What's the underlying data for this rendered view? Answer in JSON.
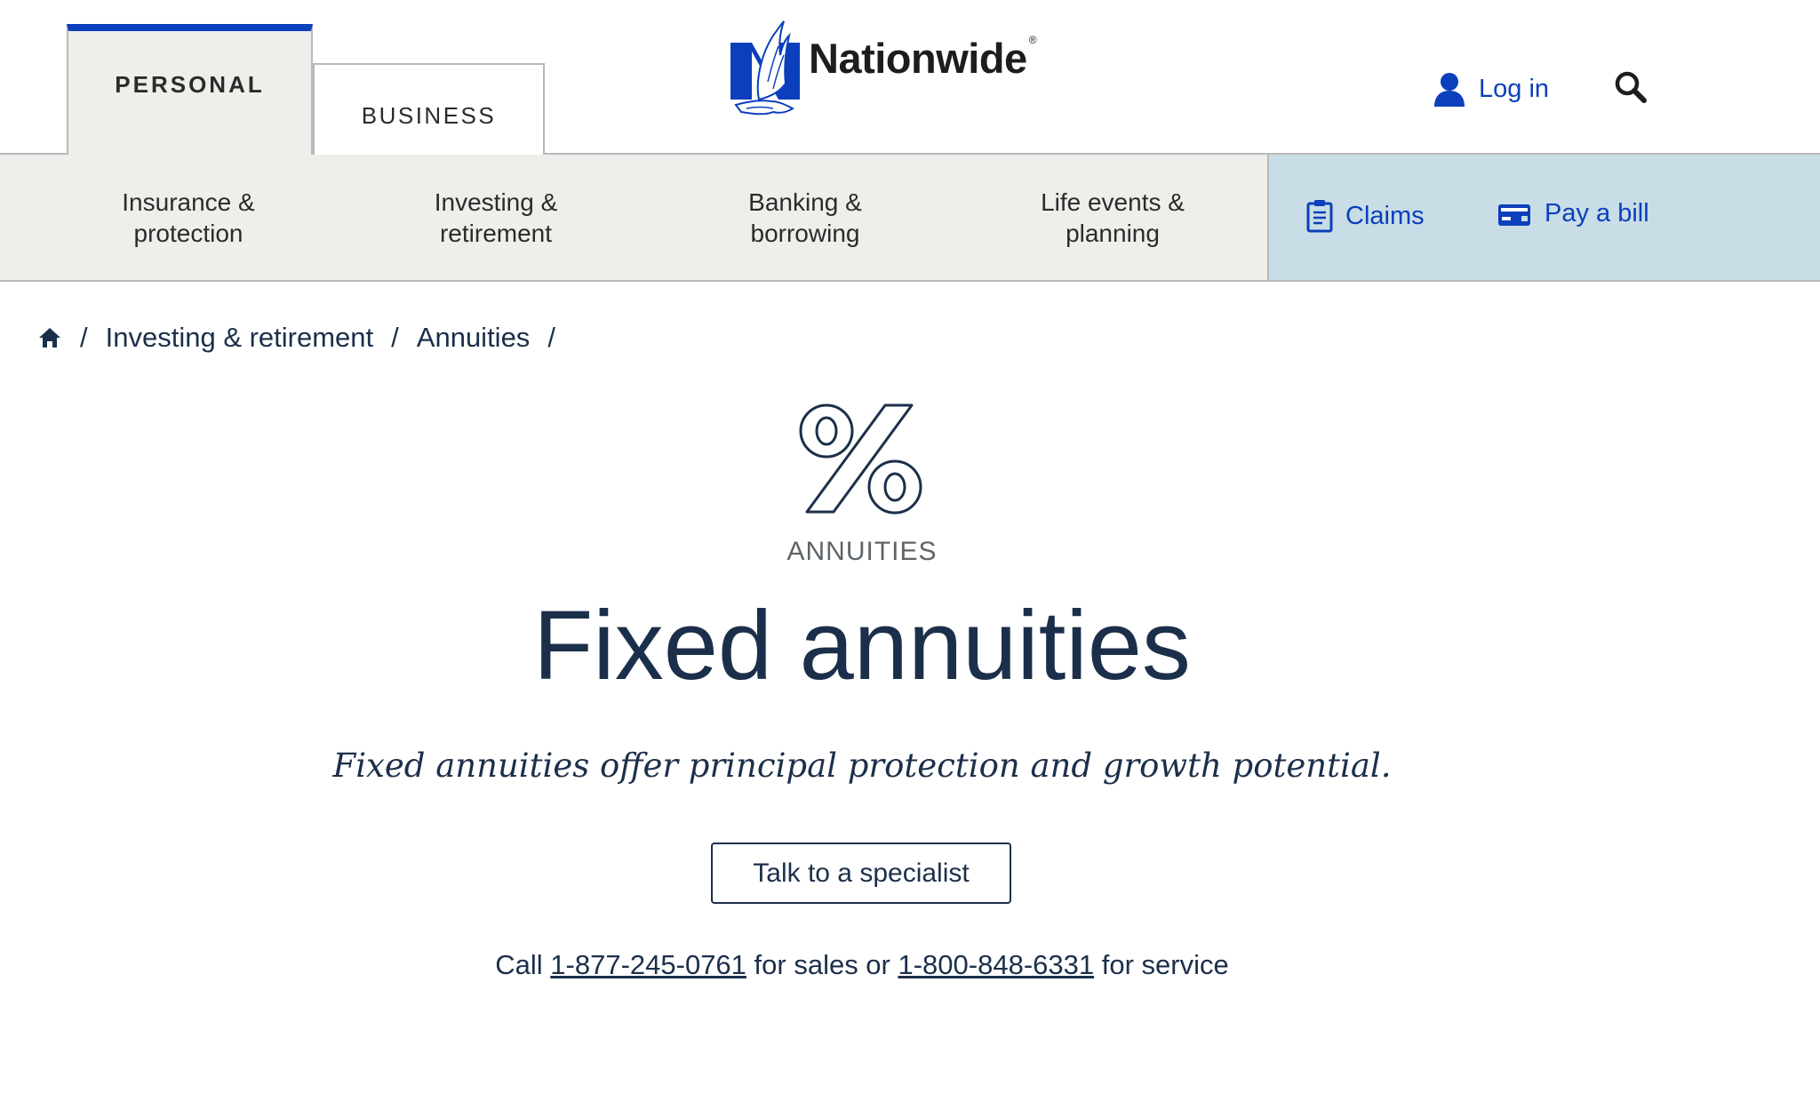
{
  "header": {
    "tabs": [
      {
        "label": "PERSONAL",
        "active": true
      },
      {
        "label": "BUSINESS",
        "active": false
      }
    ],
    "logo": {
      "text": "Nationwide",
      "reg": "®"
    },
    "login_label": "Log in",
    "search_icon": "search-icon",
    "accent_color": "#0b3fbc"
  },
  "nav": {
    "items": [
      {
        "line1": "Insurance &",
        "line2": "protection"
      },
      {
        "line1": "Investing &",
        "line2": "retirement"
      },
      {
        "line1": "Banking &",
        "line2": "borrowing"
      },
      {
        "line1": "Life events &",
        "line2": "planning"
      }
    ],
    "quick_links": [
      {
        "label": "Claims",
        "icon": "clipboard-icon"
      },
      {
        "label": "Pay a bill",
        "icon": "wallet-icon"
      }
    ],
    "quick_bg": "#c8dde6"
  },
  "breadcrumb": {
    "home_icon": "home-icon",
    "separator": "/",
    "items": [
      "Investing & retirement",
      "Annuities"
    ]
  },
  "hero": {
    "icon": "percent-icon",
    "eyebrow": "ANNUITIES",
    "title": "Fixed annuities",
    "subtitle": "Fixed annuities offer principal protection and growth potential.",
    "cta_label": "Talk to a specialist",
    "call": {
      "prefix": "Call ",
      "sales_number": "1-877-245-0761",
      "middle": " for sales or ",
      "service_number": "1-800-848-6331",
      "suffix": " for service"
    }
  }
}
